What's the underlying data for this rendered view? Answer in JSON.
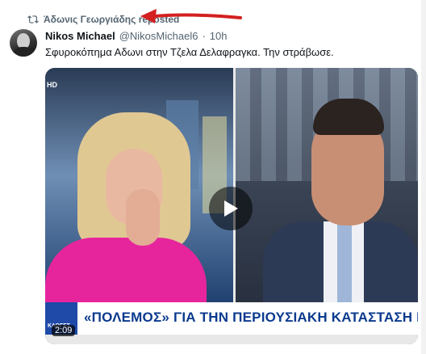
{
  "repost": {
    "label": "Άδωνις Γεωργιάδης reposted"
  },
  "tweet": {
    "name": "Nikos Michael",
    "handle": "@NikosMichael6",
    "separator": "·",
    "time": "10h",
    "text": "Σφυροκόπημα Αδωνι στην Τζελα Δελαφραγκα. Την στράβωσε."
  },
  "video": {
    "channel_logo": "HD",
    "eu_badge": "ΚΛΟΓΕΣ",
    "headline": "«ΠΟΛΕΜΟΣ» ΓΙΑ ΤΗΝ ΠΕΡΙΟΥΣΙΑΚΗ ΚΑΤΑΣΤΑΣΗ ΚΑΣΣΕ",
    "duration": "2:09"
  },
  "colors": {
    "arrow": "#d42020",
    "headline": "#0b3a8e",
    "dress": "#e6259c"
  },
  "icons": {
    "repost": "repost-icon",
    "play": "play-icon",
    "arrow": "red-arrow-annotation"
  }
}
